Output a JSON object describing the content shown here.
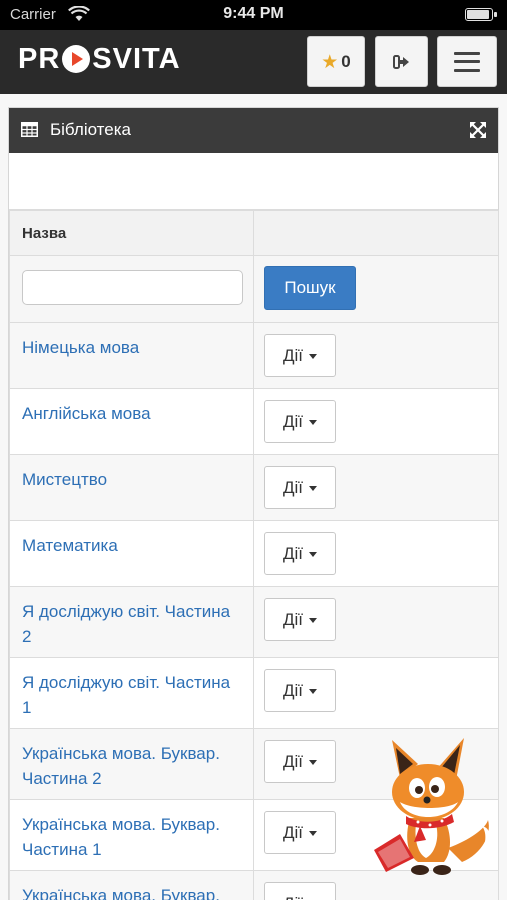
{
  "status_bar": {
    "carrier": "Carrier",
    "time": "9:44 PM"
  },
  "navbar": {
    "logo": "PROSVITA",
    "logo_parts": {
      "before": "PR",
      "after": "SVITA"
    },
    "favorites_count": "0",
    "colors": {
      "background": "#2a2a2a",
      "logo_accent": "#e8472b",
      "star": "#e9a929"
    },
    "icons": [
      "star-icon",
      "sign-out-icon",
      "hamburger-menu-icon"
    ]
  },
  "panel": {
    "title": "Бібліотека",
    "icons": [
      "table-icon",
      "expand-icon"
    ]
  },
  "table": {
    "column_header": "Назва",
    "search": {
      "value": "",
      "placeholder": "",
      "button_label": "Пошук"
    },
    "action_label": "Дії",
    "rows": [
      {
        "name": "Німецька мова"
      },
      {
        "name": "Англійська мова"
      },
      {
        "name": "Мистецтво"
      },
      {
        "name": "Математика"
      },
      {
        "name": "Я досліджую світ. Частина 2"
      },
      {
        "name": "Я досліджую світ. Частина 1"
      },
      {
        "name": "Українська мова. Буквар. Частина 2"
      },
      {
        "name": "Українська мова. Буквар. Частина 1"
      },
      {
        "name": "Українська мова. Буквар."
      }
    ],
    "colors": {
      "link": "#2d6fb5",
      "primary_button": "#3a7cc4"
    }
  }
}
